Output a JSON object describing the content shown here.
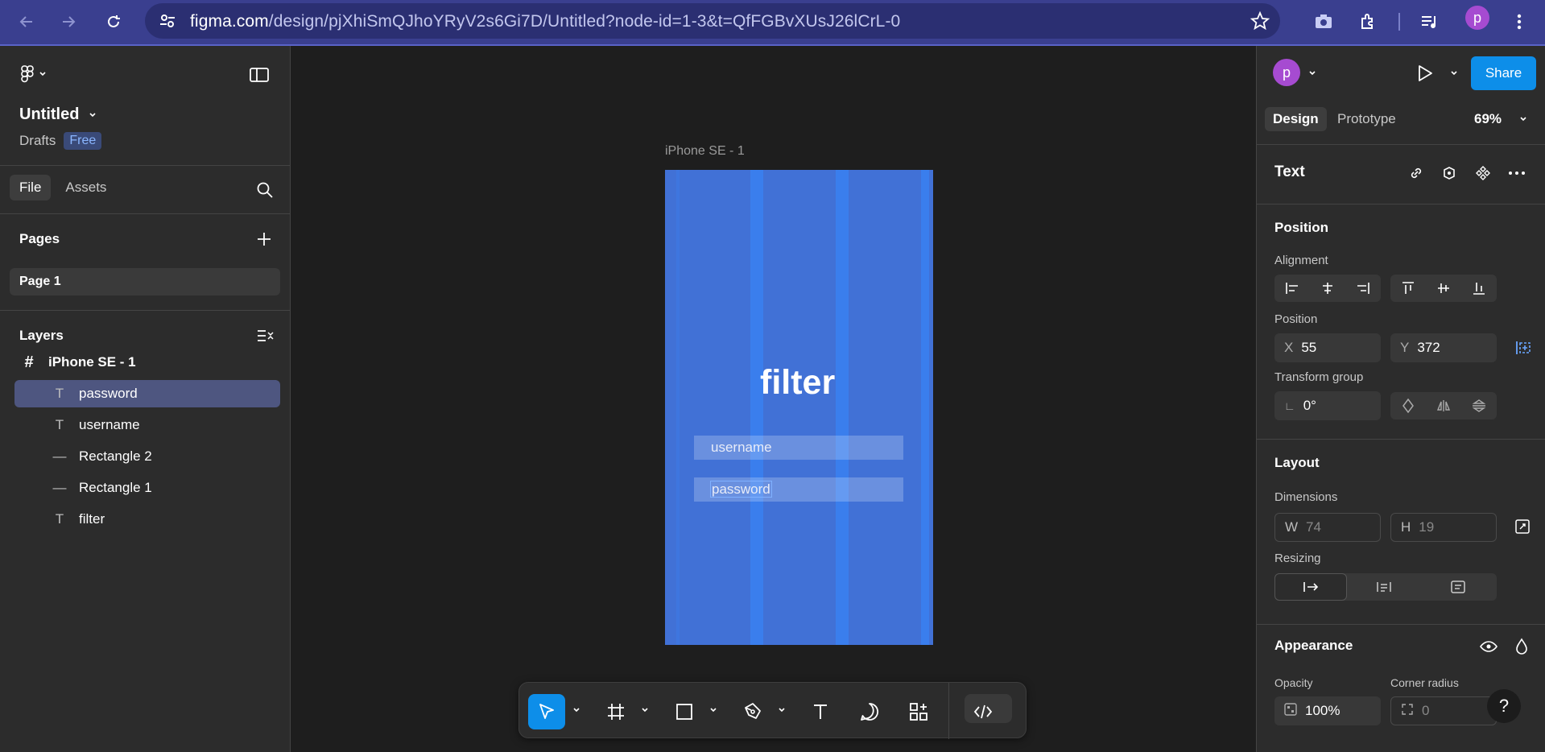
{
  "browser": {
    "url_host": "figma.com",
    "url_path": "/design/pjXhiSmQJhoYRyV2s6Gi7D/Untitled?node-id=1-3&t=QfFGBvXUsJ26lCrL-0",
    "profile_initial": "p",
    "accent": "#3a3f8f"
  },
  "left_panel": {
    "file_title": "Untitled",
    "location": "Drafts",
    "plan_badge": "Free",
    "tabs": [
      "File",
      "Assets"
    ],
    "pages_title": "Pages",
    "pages": [
      "Page 1"
    ],
    "layers_title": "Layers",
    "layers": [
      {
        "name": "iPhone SE - 1",
        "type": "frame-icon"
      },
      {
        "name": "password",
        "type": "text-icon",
        "selected": true
      },
      {
        "name": "username",
        "type": "text-icon"
      },
      {
        "name": "Rectangle 2",
        "type": "rectangle-icon"
      },
      {
        "name": "Rectangle 1",
        "type": "rectangle-icon"
      },
      {
        "name": "filter",
        "type": "text-icon"
      }
    ]
  },
  "canvas": {
    "frame_label": "iPhone SE - 1",
    "frame_color": "#4171d6",
    "title_text": "filter",
    "username_text": "username",
    "password_text": "password"
  },
  "toolbar": {
    "tools": [
      "move-tool",
      "frame-tool",
      "rectangle-tool",
      "pen-tool",
      "text-tool",
      "comment-tool",
      "actions-tool",
      "dev-mode-toggle"
    ],
    "active_tool": "move-tool",
    "accent": "#0d8ee9"
  },
  "right_panel": {
    "profile_initial": "p",
    "share_label": "Share",
    "tabs": [
      "Design",
      "Prototype"
    ],
    "zoom": "69%",
    "selection_type": "Text",
    "position_title": "Position",
    "alignment_label": "Alignment",
    "position_label": "Position",
    "x_label": "X",
    "x_value": "55",
    "y_label": "Y",
    "y_value": "372",
    "transform_label": "Transform group",
    "rotation_value": "0°",
    "layout_title": "Layout",
    "dimensions_label": "Dimensions",
    "w_label": "W",
    "w_value": "74",
    "h_label": "H",
    "h_value": "19",
    "resizing_label": "Resizing",
    "appearance_title": "Appearance",
    "opacity_label": "Opacity",
    "opacity_value": "100%",
    "corner_label": "Corner radius",
    "corner_value": "0",
    "help_label": "?"
  }
}
